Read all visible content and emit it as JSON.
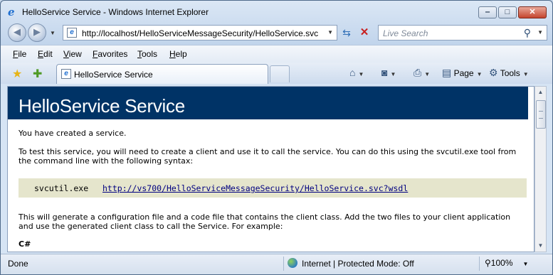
{
  "window": {
    "title": "HelloService Service - Windows Internet Explorer",
    "minimize_glyph": "‒",
    "maximize_glyph": "□",
    "close_glyph": "✕"
  },
  "toolbar": {
    "back_glyph": "◀",
    "forward_glyph": "▶",
    "address": "http://localhost/HelloServiceMessageSecurity/HelloService.svc",
    "search_placeholder": "Live Search"
  },
  "menu": {
    "items": [
      {
        "accel": "F",
        "rest": "ile"
      },
      {
        "accel": "E",
        "rest": "dit"
      },
      {
        "accel": "V",
        "rest": "iew"
      },
      {
        "accel": "F",
        "rest": "avorites",
        "pre": ""
      },
      {
        "accel": "T",
        "rest": "ools"
      },
      {
        "accel": "H",
        "rest": "elp"
      }
    ]
  },
  "tabs": {
    "active_label": "HelloService Service"
  },
  "commands": {
    "page_label": "Page",
    "tools_label": "Tools"
  },
  "page": {
    "heading": "HelloService Service",
    "p1": "You have created a service.",
    "p2": "To test this service, you will need to create a client and use it to call the service. You can do this using the svcutil.exe tool from the command line with the following syntax:",
    "code_command": "svcutil.exe",
    "code_link": "http://vs700/HelloServiceMessageSecurity/HelloService.svc?wsdl",
    "p3": "This will generate a configuration file and a code file that contains the client class. Add the two files to your client application and use the generated client class to call the Service. For example:",
    "language": "C#"
  },
  "status": {
    "text": "Done",
    "zone": "Internet | Protected Mode: Off",
    "zoom": "100%"
  },
  "colors": {
    "banner": "#003366",
    "code_background": "#e5e5cc",
    "link": "#000080"
  }
}
